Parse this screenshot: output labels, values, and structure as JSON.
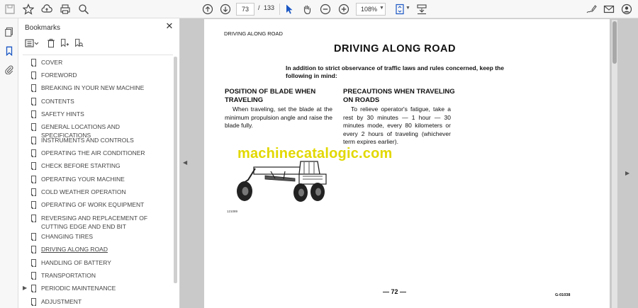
{
  "toolbar": {
    "current_page": "73",
    "page_separator": "/",
    "total_pages": "133",
    "zoom": "108%"
  },
  "bookmarks_panel": {
    "title": "Bookmarks",
    "items": [
      {
        "label": "COVER"
      },
      {
        "label": "FOREWORD"
      },
      {
        "label": "BREAKING IN YOUR NEW MACHINE"
      },
      {
        "label": "CONTENTS"
      },
      {
        "label": "SAFETY HINTS"
      },
      {
        "label": "GENERAL LOCATIONS AND SPECIFICATIONS"
      },
      {
        "label": "INSTRUMENTS AND CONTROLS"
      },
      {
        "label": "OPERATING THE AIR CONDITIONER"
      },
      {
        "label": "CHECK BEFORE STARTING"
      },
      {
        "label": "OPERATING YOUR MACHINE"
      },
      {
        "label": "COLD WEATHER OPERATION"
      },
      {
        "label": "OPERATING OF WORK EQUIPMENT"
      },
      {
        "label": "REVERSING AND REPLACEMENT OF CUTTING EDGE AND END BIT"
      },
      {
        "label": "CHANGING TIRES"
      },
      {
        "label": "DRIVING ALONG ROAD"
      },
      {
        "label": "HANDLING OF BATTERY"
      },
      {
        "label": "TRANSPORTATION"
      },
      {
        "label": "PERIODIC MAINTENANCE"
      },
      {
        "label": "ADJUSTMENT"
      }
    ]
  },
  "document": {
    "running_head": "DRIVING ALONG ROAD",
    "title": "DRIVING ALONG ROAD",
    "intro": "In addition to strict observance of traffic laws and rules concerned, keep the following in mind:",
    "section_left": {
      "heading": "POSITION OF BLADE WHEN TRAVELING",
      "body": "When traveling, set the blade at the minimum propulsion angle and raise the blade fully."
    },
    "section_right": {
      "heading": "PRECAUTIONS WHEN TRAVELING ON ROADS",
      "body": "To relieve operator's fatigue, take a rest by 30 minutes — 1 hour — 30 minutes mode, every 80 kilometers or every 2 hours of traveling (whichever term expires earlier)."
    },
    "watermark": "machinecatalogic.com",
    "figure_code": "121089",
    "page_number": "— 72 —",
    "doc_code": "G-01038"
  }
}
